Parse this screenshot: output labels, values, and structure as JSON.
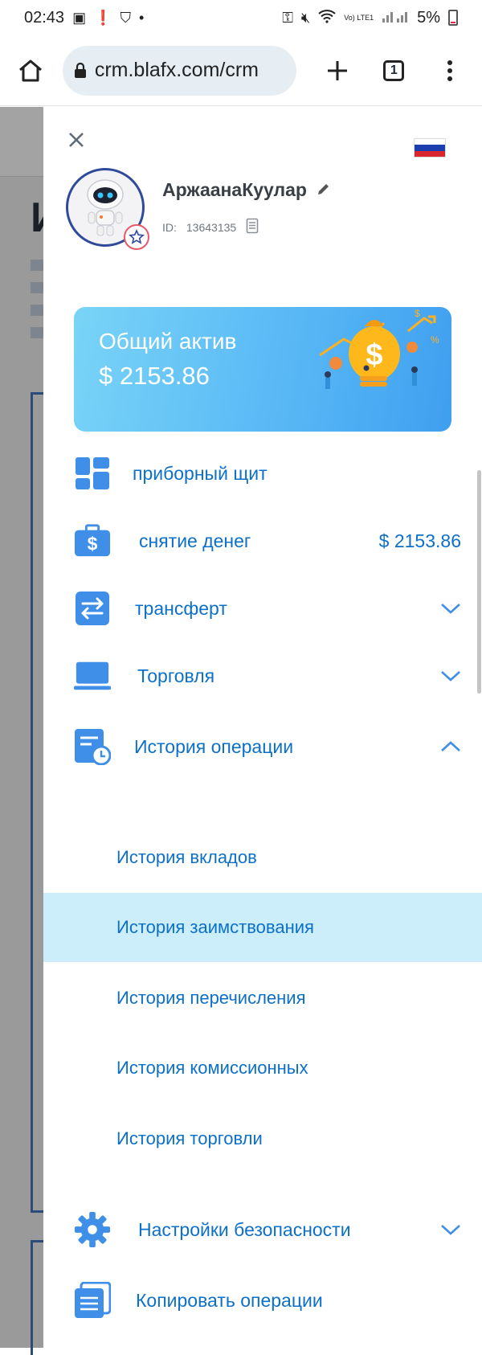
{
  "status_bar": {
    "time": "02:43",
    "battery": "5%",
    "network": "Vo) LTE1"
  },
  "browser": {
    "url": "crm.blafx.com/crm",
    "tab_count": "1"
  },
  "drawer": {
    "language_flag": "ru",
    "user": {
      "name": "АржаанаКуулар",
      "id_label": "ID:",
      "id_value": "13643135"
    },
    "asset_card": {
      "title": "Общий актив",
      "value": "$ 2153.86"
    },
    "menu": [
      {
        "label": "приборный щит",
        "icon": "dashboard-icon"
      },
      {
        "label": "снятие денег",
        "icon": "wallet-dollar-icon",
        "value": "$ 2153.86"
      },
      {
        "label": "трансферт",
        "icon": "transfer-icon",
        "chevron": "down"
      },
      {
        "label": "Торговля",
        "icon": "laptop-icon",
        "chevron": "down"
      },
      {
        "label": "История операции",
        "icon": "history-icon",
        "chevron": "up"
      },
      {
        "label": "Настройки безопасности",
        "icon": "gear-icon",
        "chevron": "down"
      },
      {
        "label": "Копировать операции",
        "icon": "copy-icon"
      }
    ],
    "history_submenu": [
      {
        "label": "История вкладов",
        "active": false
      },
      {
        "label": "История заимствования",
        "active": true
      },
      {
        "label": "История перечисления",
        "active": false
      },
      {
        "label": "История комиссионных",
        "active": false
      },
      {
        "label": "История торговли",
        "active": false
      }
    ]
  },
  "colors": {
    "accent": "#0d70c8",
    "icon_blue": "#3f8fe8",
    "active_row": "#cceefb",
    "card_gradient_start": "#79d4f7",
    "card_gradient_end": "#3f9ff0"
  }
}
